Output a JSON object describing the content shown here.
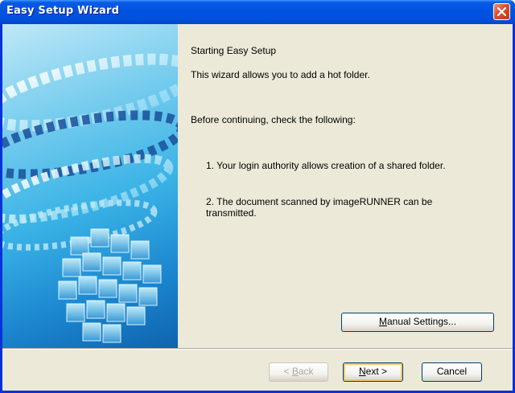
{
  "window": {
    "title": "Easy Setup Wizard"
  },
  "content": {
    "heading": "Starting Easy Setup",
    "intro": "This wizard allows you to add a hot folder.",
    "check_intro": "Before continuing, check the following:",
    "items": [
      "1.  Your login authority allows creation of a shared folder.",
      "2.  The document scanned by imageRUNNER can be transmitted."
    ]
  },
  "buttons": {
    "manual_settings": {
      "mnemonic": "M",
      "rest": "anual Settings..."
    },
    "back": {
      "prefix": "< ",
      "mnemonic": "B",
      "rest": "ack"
    },
    "next": {
      "mnemonic": "N",
      "rest": "ext >"
    },
    "cancel": "Cancel"
  },
  "colors": {
    "titlebar": "#0053e1",
    "dialog_background": "#ece9d8",
    "close_button": "#d84f2c"
  }
}
